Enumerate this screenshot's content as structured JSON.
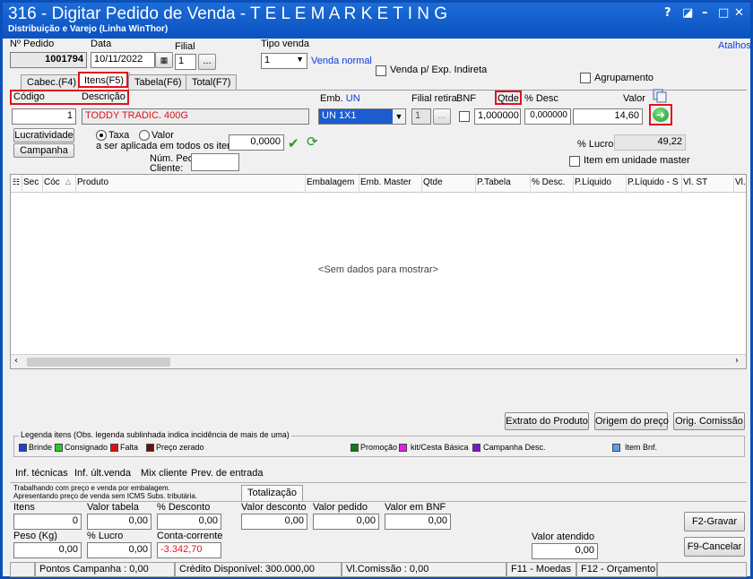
{
  "window": {
    "title": "316 - Digitar Pedido de Venda - T E L E M A R K E T I N G",
    "subtitle": "Distribuição e Varejo (Linha WinThor)",
    "controls": [
      "?",
      "◪",
      "–",
      "□",
      "✕"
    ]
  },
  "header": {
    "pedido_label": "Nº Pedido",
    "pedido_value": "1001794",
    "data_label": "Data",
    "data_value": "10/11/2022",
    "calendar_icon": "calendar-icon",
    "filial_label": "Filial",
    "filial_value": "1",
    "filial_btn": "...",
    "tipo_venda_label": "Tipo venda",
    "tipo_venda_value": "1",
    "tipo_venda_text": "Venda normal",
    "atalhos": "Atalhos",
    "venda_exp_label": "Venda p/ Exp. Indireta",
    "agrupamento_label": "Agrupamento"
  },
  "tabs": [
    {
      "label": "Cabec.(F4)"
    },
    {
      "label": "Itens(F5)"
    },
    {
      "label": "Tabela(F6)"
    },
    {
      "label": "Total(F7)"
    }
  ],
  "item": {
    "codigo_label": "Código",
    "descricao_label": "Descrição",
    "codigo_value": "1",
    "descricao_value": "TODDY TRADIC. 400G",
    "emb_label": "Emb.",
    "emb_un": "UN",
    "emb_value": "UN 1X1",
    "filial_retira_label": "Filial retira",
    "filial_retira_value": "1",
    "filial_retira_btn": "...",
    "bnf_label": "BNF",
    "qtde_label": "Qtde",
    "qtde_value": "1,000000",
    "desc_label": "% Desc",
    "desc_value": "0,000000",
    "valor_label": "Valor",
    "valor_value": "14,60"
  },
  "actions": {
    "lucratividade": "Lucratividade",
    "campanha": "Campanha",
    "taxa_label": "Taxa",
    "valor_label": "Valor",
    "aplicada_label": "a ser aplicada em todos os itens:",
    "aplicada_value": "0,0000",
    "num_ped_label_1": "Núm. Ped.",
    "num_ped_label_2": "Cliente:",
    "lucro_label": "% Lucro:",
    "lucro_value": "49,22",
    "item_master_label": "Item em unidade master"
  },
  "grid": {
    "columns": [
      "Sec",
      "Cóc",
      "Produto",
      "Embalagem",
      "Emb. Master",
      "Qtde",
      "P.Tabela",
      "% Desc.",
      "P.Líquido",
      "P.Líquido - S",
      "Vl. ST",
      "Vl."
    ],
    "empty_text": "<Sem dados para mostrar>"
  },
  "buttons": {
    "extrato": "Extrato do Produto",
    "origem": "Origem do preço",
    "orig_comissao": "Orig. Comissão",
    "f2": "F2-Gravar",
    "f9": "F9-Cancelar"
  },
  "legend": {
    "title": "Legenda itens (Obs. legenda sublinhada indica incidência de mais de uma)",
    "items": [
      {
        "label": "Brinde",
        "color": "#1f3fd6"
      },
      {
        "label": "Consignado",
        "color": "#28c828"
      },
      {
        "label": "Falta",
        "color": "#e01010"
      },
      {
        "label": "Preço zerado",
        "color": "#6a0f0f"
      },
      {
        "label": "Promoção",
        "color": "#0f7a1a"
      },
      {
        "label": "kit/Cesta Básica",
        "color": "#e020e0"
      },
      {
        "label": "Campanha Desc.",
        "color": "#7a18c8"
      },
      {
        "label": "Item Bnf.",
        "color": "#5aa0e8"
      }
    ]
  },
  "bottom_tabs": [
    "Inf. técnicas",
    "Inf. últ.venda",
    "Mix cliente",
    "Prev. de entrada"
  ],
  "info": {
    "line1": "Trabalhando com preço e venda por embalagem.",
    "line2": "Apresentando preço de venda sem ICMS Subs. tributária.",
    "totalizacao": "Totalização"
  },
  "totals": {
    "itens_label": "Itens",
    "itens_value": "0",
    "valor_tabela_label": "Valor tabela",
    "valor_tabela_value": "0,00",
    "pct_desconto_label": "% Desconto",
    "pct_desconto_value": "0,00",
    "valor_desconto_label": "Valor desconto",
    "valor_desconto_value": "0,00",
    "valor_pedido_label": "Valor pedido",
    "valor_pedido_value": "0,00",
    "valor_bnf_label": "Valor em BNF",
    "valor_bnf_value": "0,00",
    "peso_label": "Peso (Kg)",
    "peso_value": "0,00",
    "pct_lucro_label": "% Lucro",
    "pct_lucro_value": "0,00",
    "conta_corrente_label": "Conta-corrente",
    "conta_corrente_value": "-3.342,70",
    "valor_atendido_label": "Valor atendido",
    "valor_atendido_value": "0,00"
  },
  "status": {
    "pontos": "Pontos Campanha : 0,00",
    "credito": "Crédito Disponível: 300.000,00",
    "comissao": "Vl.Comissão : 0,00",
    "f11": "F11 - Moedas",
    "f12": "F12 - Orçamento"
  }
}
